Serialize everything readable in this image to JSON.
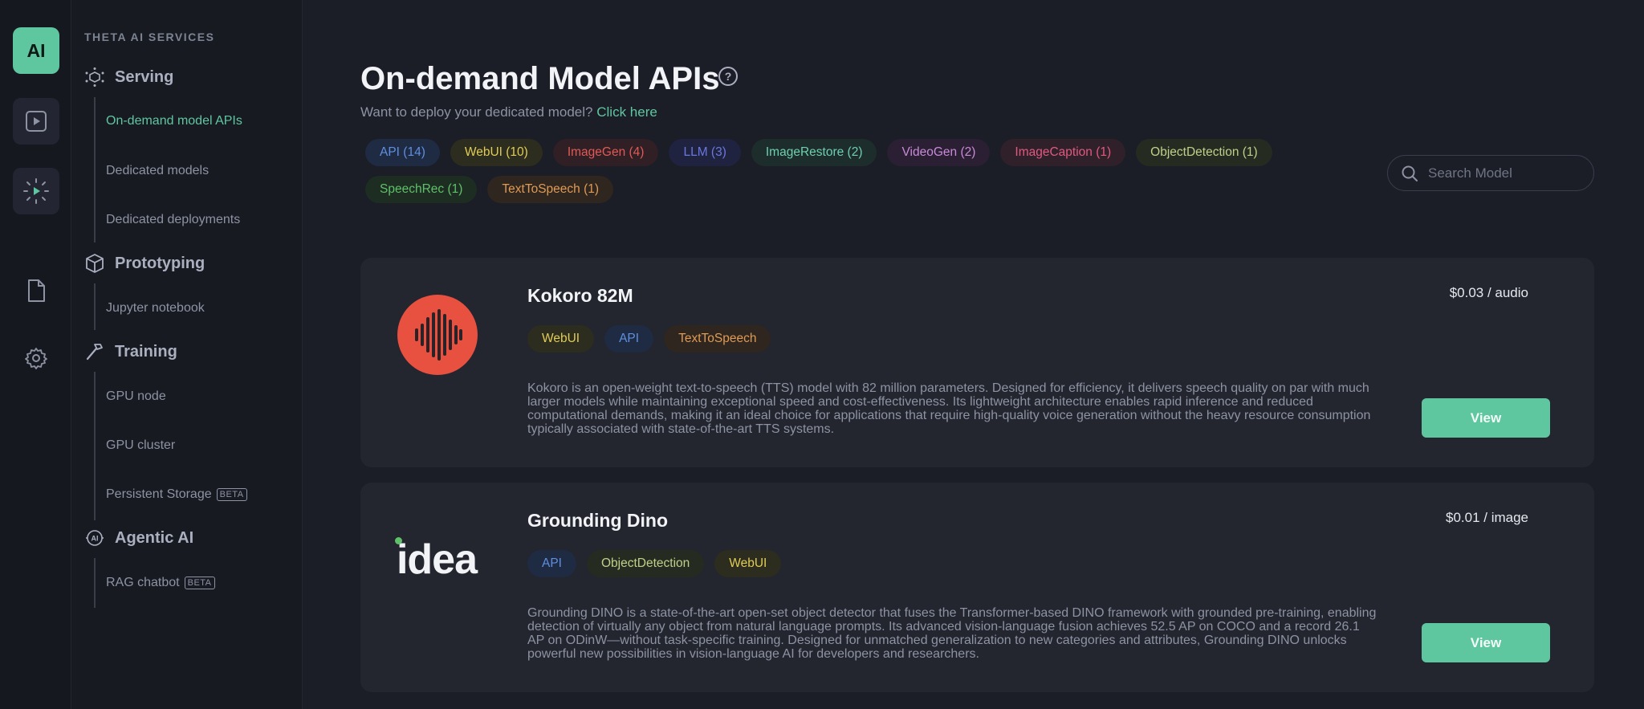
{
  "rail": {
    "logo_text": "AI"
  },
  "sidebar": {
    "title": "THETA AI SERVICES",
    "sections": [
      {
        "label": "Serving",
        "items": [
          "On-demand model APIs",
          "Dedicated models",
          "Dedicated deployments"
        ]
      },
      {
        "label": "Prototyping",
        "items": [
          "Jupyter notebook"
        ]
      },
      {
        "label": "Training",
        "items": [
          "GPU node",
          "GPU cluster",
          "Persistent Storage"
        ]
      },
      {
        "label": "Agentic AI",
        "items": [
          "RAG chatbot"
        ]
      }
    ],
    "beta_label": "BETA"
  },
  "header": {
    "title": "On-demand Model APIs",
    "help_glyph": "?",
    "subtitle": "Want to deploy your dedicated model?",
    "subtitle_link": "Click here"
  },
  "filters": [
    "API (14)",
    "WebUI (10)",
    "ImageGen (4)",
    "LLM (3)",
    "ImageRestore (2)",
    "VideoGen (2)",
    "ImageCaption (1)",
    "ObjectDetection (1)",
    "SpeechRec (1)",
    "TextToSpeech (1)"
  ],
  "search": {
    "placeholder": "Search Model"
  },
  "models": [
    {
      "name": "Kokoro 82M",
      "tags": [
        "WebUI",
        "API",
        "TextToSpeech"
      ],
      "price": "$0.03 / audio",
      "description": "Kokoro is an open-weight text-to-speech (TTS) model with 82 million parameters. Designed for efficiency, it delivers speech quality on par with much larger models while maintaining exceptional speed and cost-effectiveness. Its lightweight architecture enables rapid inference and reduced computational demands, making it an ideal choice for applications that require high-quality voice generation without the heavy resource consumption typically associated with state-of-the-art TTS systems.",
      "button": "View",
      "logo_color": "#e8503f"
    },
    {
      "name": "Grounding Dino",
      "tags": [
        "API",
        "ObjectDetection",
        "WebUI"
      ],
      "price": "$0.01 / image",
      "description": "Grounding DINO is a state-of-the-art open-set object detector that fuses the Transformer-based DINO framework with grounded pre-training, enabling detection of virtually any object from natural language prompts. Its advanced vision-language fusion achieves 52.5 AP on COCO and a record 26.1 AP on ODinW—without task-specific training. Designed for unmatched generalization to new categories and attributes, Grounding DINO unlocks powerful new possibilities in vision-language AI for developers and researchers.",
      "button": "View",
      "logo_text": "idea"
    }
  ],
  "colors": {
    "accent": "#5fc7a0",
    "background": "#1b1d27",
    "card": "#23252f"
  }
}
